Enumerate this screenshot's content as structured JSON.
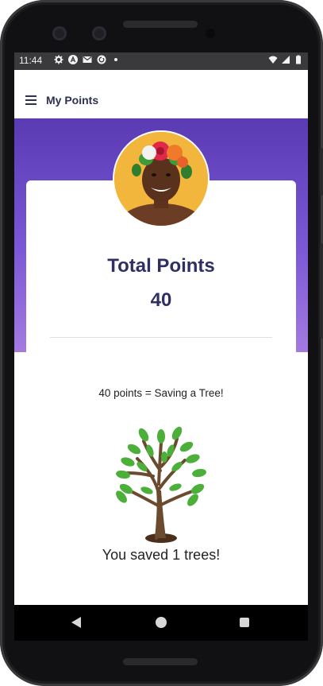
{
  "status_bar": {
    "time": "11:44",
    "icons": [
      "gear-icon",
      "a-badge-icon",
      "mail-icon",
      "sync-icon",
      "dot-icon"
    ],
    "right_icons": [
      "wifi-icon",
      "signal-icon",
      "battery-icon"
    ]
  },
  "appbar": {
    "menu_icon": "hamburger-menu-icon",
    "title": "My Points"
  },
  "profile": {
    "avatar_alt": "profile photo"
  },
  "points": {
    "label": "Total Points",
    "value": "40",
    "conversion_text": "40 points = Saving a Tree!",
    "saved_text": "You saved 1 trees!"
  },
  "nav": {
    "back": "back-icon",
    "home": "home-icon",
    "recents": "recents-icon"
  },
  "colors": {
    "primary_text": "#2e2f63",
    "gradient_top": "#5a3bb3",
    "gradient_bottom": "#a47ae0",
    "leaf_green": "#4caf3a",
    "trunk_brown": "#6b4a2e"
  }
}
